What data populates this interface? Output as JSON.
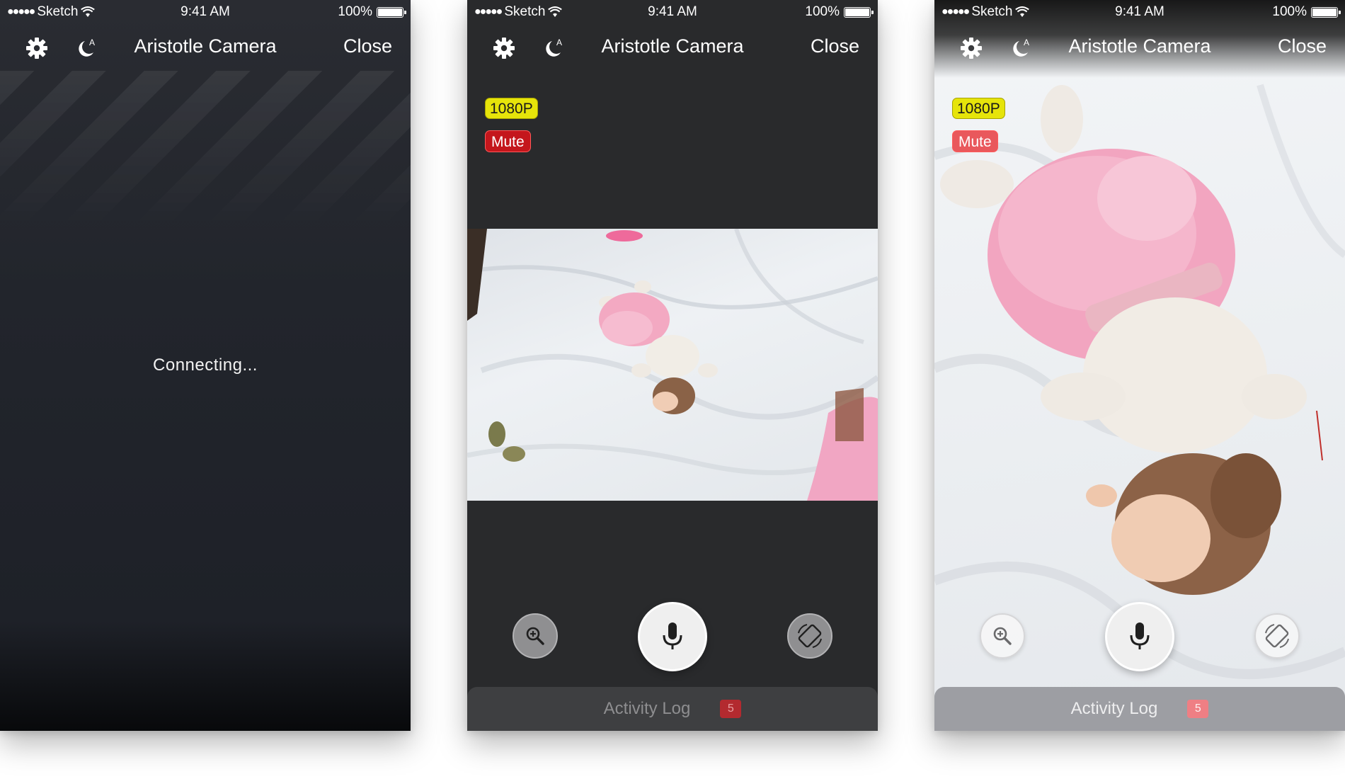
{
  "status_bar": {
    "carrier": "Sketch",
    "time": "9:41 AM",
    "battery": "100%"
  },
  "nav": {
    "title": "Aristotle Camera",
    "close_label": "Close",
    "night_mode_letter": "A"
  },
  "screens": {
    "connecting": {
      "message": "Connecting..."
    },
    "stream": {
      "resolution_badge": "1080P",
      "mute_label": "Mute",
      "activity_log_label": "Activity Log",
      "activity_log_count": "5"
    }
  },
  "colors": {
    "resolution_badge": "#e6e40a",
    "mute_badge": "#c4161c",
    "dark_background": "#292a2c"
  },
  "icons": [
    "settings-gear-icon",
    "night-mode-moon-icon",
    "zoom-in-icon",
    "microphone-icon",
    "rotate-screen-icon"
  ]
}
